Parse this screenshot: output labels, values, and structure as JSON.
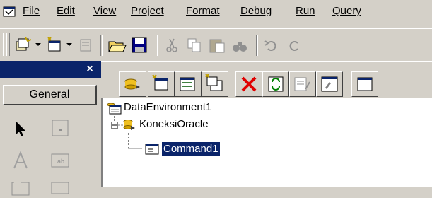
{
  "menu": [
    {
      "label": "File"
    },
    {
      "label": "Edit"
    },
    {
      "label": "View"
    },
    {
      "label": "Project"
    },
    {
      "label": "Format"
    },
    {
      "label": "Debug"
    },
    {
      "label": "Run"
    },
    {
      "label": "Query"
    }
  ],
  "toolbar": {
    "icons": [
      "add-project-icon",
      "add-form-icon",
      "menu-editor-icon",
      "open-project-icon",
      "save-project-icon",
      "cut-icon",
      "copy-icon",
      "paste-icon",
      "find-icon",
      "undo-icon",
      "redo-icon"
    ]
  },
  "toolbox": {
    "tab_label": "General",
    "close_glyph": "×",
    "tools": [
      "pointer-icon",
      "picturebox-icon",
      "label-icon",
      "textbox-icon",
      "frame-icon"
    ]
  },
  "designer": {
    "icons": [
      "add-connection-icon",
      "add-command-icon",
      "insert-stored-procedure-icon",
      "add-child-command-icon",
      "delete-icon",
      "refresh-icon",
      "design-icon",
      "properties-icon",
      "view-code-icon"
    ]
  },
  "tree": {
    "root": {
      "label": "DataEnvironment1"
    },
    "connection": {
      "label": "KoneksiOracle"
    },
    "command": {
      "label": "Command1",
      "selected": true
    }
  },
  "colors": {
    "face": "#d4d0c8",
    "caption": "#0a246a",
    "selection": "#0a246a"
  }
}
